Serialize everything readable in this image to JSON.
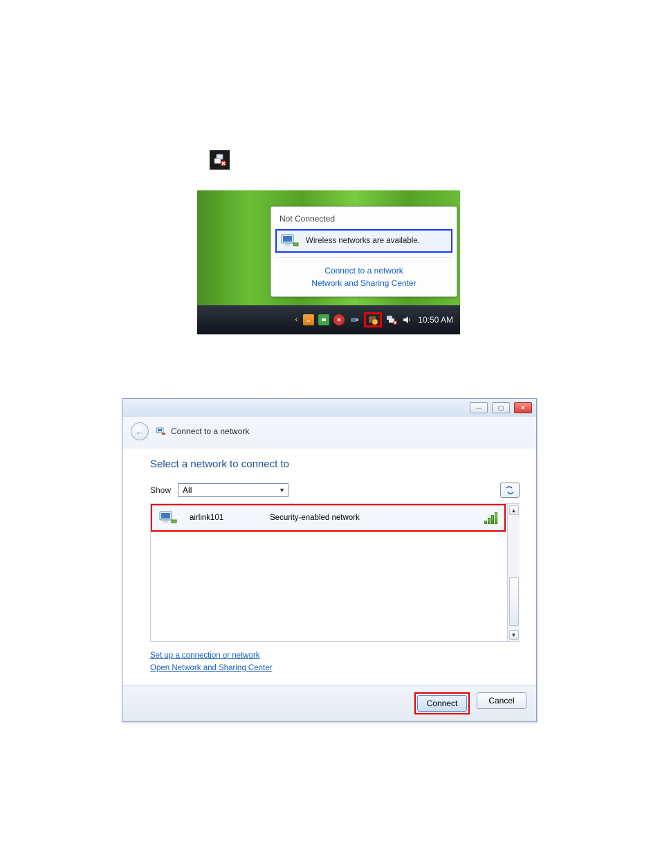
{
  "popup": {
    "title": "Not Connected",
    "message": "Wireless networks are available.",
    "link_connect": "Connect to a network",
    "link_center": "Network and Sharing Center"
  },
  "taskbar": {
    "time": "10:50 AM"
  },
  "dialog": {
    "title": "Connect to a network",
    "heading": "Select a network to connect to",
    "show_label": "Show",
    "show_value": "All",
    "link_setup": "Set up a connection or network",
    "link_open_center": "Open Network and Sharing Center",
    "connect_label": "Connect",
    "cancel_label": "Cancel"
  },
  "networks": {
    "0": {
      "name": "airlink101",
      "desc": "Security-enabled network"
    }
  }
}
